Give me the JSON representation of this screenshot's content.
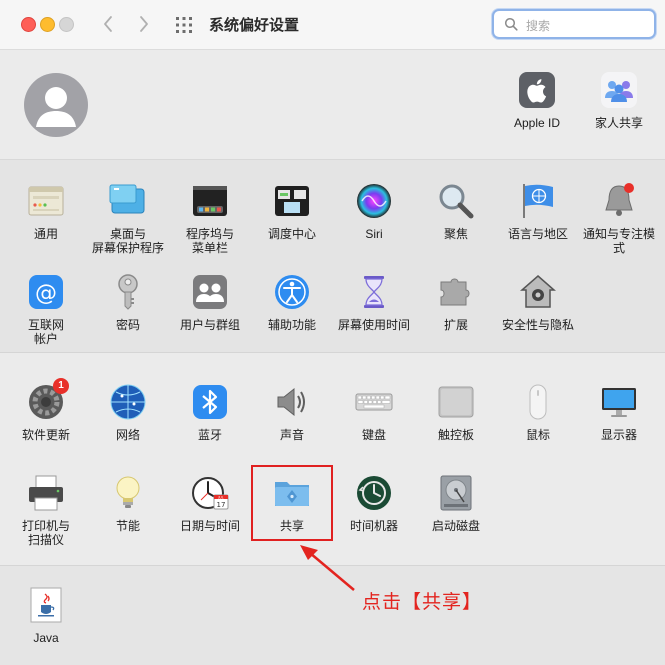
{
  "window": {
    "title": "系统偏好设置",
    "search_placeholder": "搜索"
  },
  "account": [
    {
      "id": "apple-id",
      "label": "Apple ID"
    },
    {
      "id": "family-sharing",
      "label": "家人共享"
    }
  ],
  "main_prefs": [
    {
      "id": "general",
      "label": "通用",
      "icon": "general-icon"
    },
    {
      "id": "desktop-screensaver",
      "label": "桌面与\n屏幕保护程序",
      "icon": "desktop-icon"
    },
    {
      "id": "dock-menubar",
      "label": "程序坞与\n菜单栏",
      "icon": "dock-icon"
    },
    {
      "id": "mission-control",
      "label": "调度中心",
      "icon": "mission-control-icon"
    },
    {
      "id": "siri",
      "label": "Siri",
      "icon": "siri-icon"
    },
    {
      "id": "spotlight",
      "label": "聚焦",
      "icon": "magnifier-icon"
    },
    {
      "id": "language-region",
      "label": "语言与地区",
      "icon": "flag-icon"
    },
    {
      "id": "notifications-focus",
      "label": "通知与专注模式",
      "icon": "bell-icon"
    },
    {
      "id": "internet-accounts",
      "label": "互联网\n帐户",
      "icon": "at-icon"
    },
    {
      "id": "passwords",
      "label": "密码",
      "icon": "key-icon"
    },
    {
      "id": "users-groups",
      "label": "用户与群组",
      "icon": "users-icon"
    },
    {
      "id": "accessibility",
      "label": "辅助功能",
      "icon": "accessibility-icon"
    },
    {
      "id": "screen-time",
      "label": "屏幕使用时间",
      "icon": "hourglass-icon"
    },
    {
      "id": "extensions",
      "label": "扩展",
      "icon": "puzzle-icon"
    },
    {
      "id": "security-privacy",
      "label": "安全性与隐私",
      "icon": "house-icon"
    }
  ],
  "hardware_prefs": [
    {
      "id": "software-update",
      "label": "软件更新",
      "icon": "gear-icon",
      "badge": "1"
    },
    {
      "id": "network",
      "label": "网络",
      "icon": "globe-icon"
    },
    {
      "id": "bluetooth",
      "label": "蓝牙",
      "icon": "bluetooth-icon"
    },
    {
      "id": "sound",
      "label": "声音",
      "icon": "speaker-icon"
    },
    {
      "id": "keyboard",
      "label": "键盘",
      "icon": "keyboard-icon"
    },
    {
      "id": "trackpad",
      "label": "触控板",
      "icon": "trackpad-icon"
    },
    {
      "id": "mouse",
      "label": "鼠标",
      "icon": "mouse-icon"
    },
    {
      "id": "displays",
      "label": "显示器",
      "icon": "monitor-icon"
    },
    {
      "id": "printers-scanners",
      "label": "打印机与\n扫描仪",
      "icon": "printer-icon"
    },
    {
      "id": "energy-saver",
      "label": "节能",
      "icon": "lightbulb-icon"
    },
    {
      "id": "date-time",
      "label": "日期与时间",
      "icon": "clock-icon",
      "calendar_day": "17",
      "calendar_month": "JUL"
    },
    {
      "id": "sharing",
      "label": "共享",
      "icon": "folder-icon"
    },
    {
      "id": "time-machine",
      "label": "时间机器",
      "icon": "time-machine-icon"
    },
    {
      "id": "startup-disk",
      "label": "启动磁盘",
      "icon": "disk-icon"
    }
  ],
  "other_prefs": [
    {
      "id": "java",
      "label": "Java",
      "icon": "java-icon"
    }
  ],
  "annotation": {
    "text": "点击【共享】",
    "color": "#e3241f"
  }
}
